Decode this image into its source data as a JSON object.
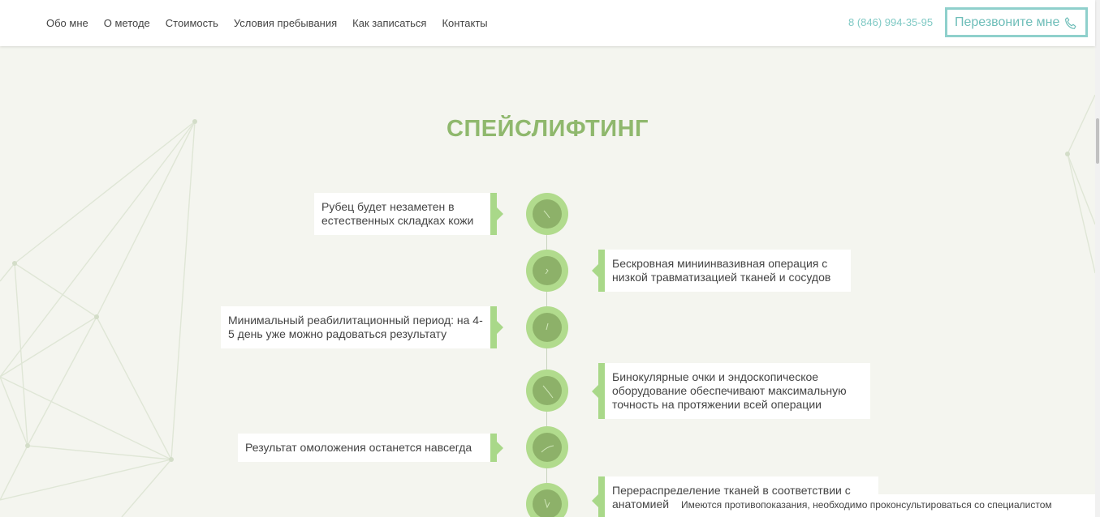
{
  "header": {
    "nav": [
      "Обо мне",
      "О методе",
      "Стоимость",
      "Условия пребывания",
      "Как записаться",
      "Контакты"
    ],
    "phone": "8 (846) 994-35-95",
    "callback_label": "Перезвоните мне"
  },
  "section": {
    "title": "СПЕЙСЛИФТИНГ"
  },
  "timeline": {
    "items": [
      {
        "side": "left",
        "text": "Рубец будет незаметен в естественных складках кожи"
      },
      {
        "side": "right",
        "text": "Бескровная миниинвазивная операция с низкой травматизацией тканей и сосудов"
      },
      {
        "side": "left",
        "text": "Минимальный реабилитационный период: на 4-5 день уже можно радоваться результату"
      },
      {
        "side": "right",
        "text": "Бинокулярные очки и эндоскопическое оборудование обеспечивают максимальную точность на протяжении всей операции"
      },
      {
        "side": "left",
        "text": "Результат омоложения останется навсегда"
      },
      {
        "side": "right",
        "text": "Перераспределение тканей в соответствии с анатомией"
      }
    ]
  },
  "notice": "Имеются противопоказания, необходимо проконсультироваться со специалистом",
  "colors": {
    "accent_green": "#8fb86d",
    "accent_teal": "#7fc9c4",
    "background": "#f4f5ef"
  }
}
